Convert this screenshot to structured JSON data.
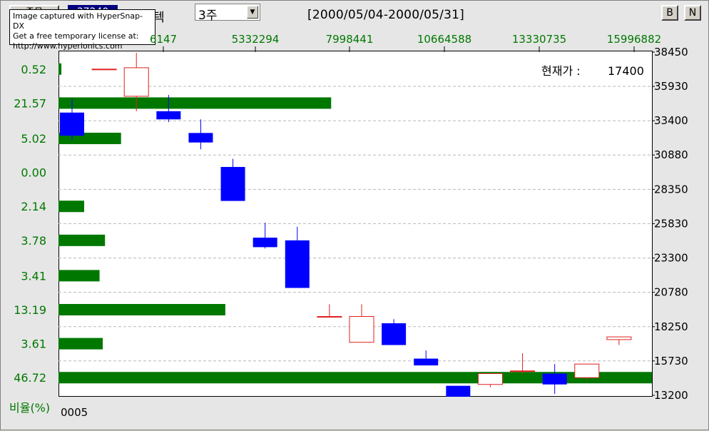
{
  "header": {
    "stock_button_label": "종목",
    "stock_code": "37240",
    "stock_name": "텍",
    "period_value": "3주",
    "date_range": "[2000/05/04-2000/05/31]",
    "b_button": "B",
    "n_button": "N"
  },
  "watermark": {
    "line1": "Image captured with HyperSnap-DX",
    "line2": "Get a free temporary license at:",
    "line3": "http://www.hyperionics.com"
  },
  "chart_meta": {
    "current_price_label": "현재가 :",
    "current_price_value": "17400",
    "ratio_label": "비율(%)",
    "bottom_label": "0005",
    "colors": {
      "up": "#e02020",
      "down": "#0000ff",
      "volume": "#007800",
      "axis_text": "#007800",
      "grid": "#b8b8b8"
    }
  },
  "chart_data": [
    {
      "type": "candlestick",
      "title": "",
      "ylabel": "",
      "ylim": [
        13200,
        38450
      ],
      "yticks": [
        38450,
        35930,
        33400,
        30880,
        28350,
        25830,
        23300,
        20780,
        18250,
        15730,
        13200
      ],
      "candles": [
        {
          "open": 34000,
          "close": 32300,
          "high": 35000,
          "low": 32000
        },
        {
          "open": 37200,
          "close": 37200,
          "high": 37200,
          "low": 37200
        },
        {
          "open": 35200,
          "close": 37300,
          "high": 38400,
          "low": 34100
        },
        {
          "open": 34100,
          "close": 33500,
          "high": 35300,
          "low": 33300
        },
        {
          "open": 32500,
          "close": 31800,
          "high": 33500,
          "low": 31300
        },
        {
          "open": 30000,
          "close": 27500,
          "high": 30600,
          "low": 27500
        },
        {
          "open": 24800,
          "close": 24100,
          "high": 25900,
          "low": 24000
        },
        {
          "open": 24600,
          "close": 21100,
          "high": 25600,
          "low": 21100
        },
        {
          "open": 19000,
          "close": 19000,
          "high": 19900,
          "low": 19000
        },
        {
          "open": 17100,
          "close": 19000,
          "high": 19900,
          "low": 17100
        },
        {
          "open": 18500,
          "close": 16900,
          "high": 18800,
          "low": 16900
        },
        {
          "open": 15900,
          "close": 15400,
          "high": 16500,
          "low": 15400
        },
        {
          "open": 13900,
          "close": 13100,
          "high": 13900,
          "low": 13100
        },
        {
          "open": 14000,
          "close": 14800,
          "high": 14800,
          "low": 13800
        },
        {
          "open": 15000,
          "close": 15000,
          "high": 16300,
          "low": 14800
        },
        {
          "open": 14800,
          "close": 14000,
          "high": 15500,
          "low": 13300
        },
        {
          "open": 14500,
          "close": 15500,
          "high": 15500,
          "low": 14300
        },
        {
          "open": 17300,
          "close": 17500,
          "high": 17500,
          "low": 16900
        }
      ]
    },
    {
      "type": "bar",
      "title": "",
      "xlabel": "",
      "ylabel": "비율(%)",
      "xlim": [
        0,
        18500000
      ],
      "xticks": [
        "6147",
        "5332294",
        "7998441",
        "10664588",
        "13330735",
        "15996882"
      ],
      "price_levels": [
        37200,
        34700,
        32100,
        29600,
        27100,
        24600,
        22000,
        19500,
        17000,
        14500
      ],
      "ratios": [
        "0.52",
        "21.57",
        "5.02",
        "0.00",
        "2.14",
        "3.78",
        "3.41",
        "13.19",
        "3.61",
        "46.72"
      ],
      "values": [
        90000,
        8500000,
        1950000,
        0,
        800000,
        1450000,
        1280000,
        5200000,
        1380000,
        18500000
      ]
    }
  ]
}
